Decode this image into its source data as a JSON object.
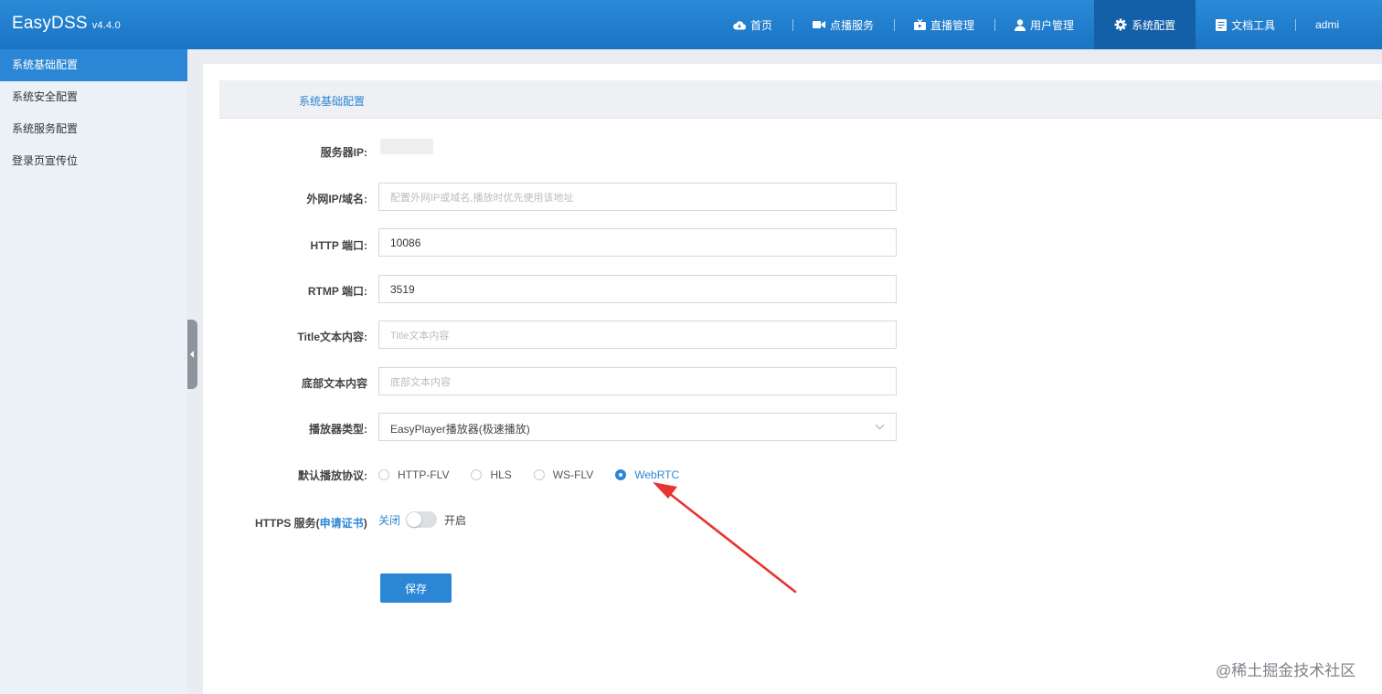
{
  "app": {
    "name": "EasyDSS",
    "version": "v4.4.0"
  },
  "nav": [
    {
      "label": "首页",
      "icon": "cloud-icon"
    },
    {
      "label": "点播服务",
      "icon": "video-camera-icon"
    },
    {
      "label": "直播管理",
      "icon": "live-tv-icon"
    },
    {
      "label": "用户管理",
      "icon": "user-icon"
    },
    {
      "label": "系统配置",
      "icon": "gear-icon",
      "active": true
    },
    {
      "label": "文档工具",
      "icon": "document-icon"
    },
    {
      "label": "admi"
    }
  ],
  "sidebar": {
    "items": [
      {
        "label": "系统基础配置",
        "active": true
      },
      {
        "label": "系统安全配置"
      },
      {
        "label": "系统服务配置"
      },
      {
        "label": "登录页宣传位"
      }
    ]
  },
  "panel": {
    "title": "系统基础配置"
  },
  "form": {
    "server_ip": {
      "label": "服务器IP:"
    },
    "external_ip": {
      "label": "外网IP/域名:",
      "value": "",
      "placeholder": "配置外网IP或域名,播放时优先使用该地址"
    },
    "http_port": {
      "label": "HTTP 端口:",
      "value": "10086"
    },
    "rtmp_port": {
      "label": "RTMP 端口:",
      "value": "3519"
    },
    "title_text": {
      "label": "Title文本内容:",
      "value": "",
      "placeholder": "Title文本内容"
    },
    "footer_text": {
      "label": "底部文本内容",
      "value": "",
      "placeholder": "底部文本内容"
    },
    "player_type": {
      "label": "播放器类型:",
      "value": "EasyPlayer播放器(极速播放)"
    },
    "protocol": {
      "label": "默认播放协议:",
      "options": [
        "HTTP-FLV",
        "HLS",
        "WS-FLV",
        "WebRTC"
      ],
      "selected": "WebRTC"
    },
    "https": {
      "label": "HTTPS 服务(",
      "link": "申请证书",
      "label_end": ")",
      "off_label": "关闭",
      "on_label": "开启",
      "enabled": false
    },
    "save_label": "保存"
  },
  "colors": {
    "accent": "#2b86d6",
    "topbar": "#1a73c4",
    "arrow": "#e8332f"
  },
  "watermark": "@稀土掘金技术社区"
}
